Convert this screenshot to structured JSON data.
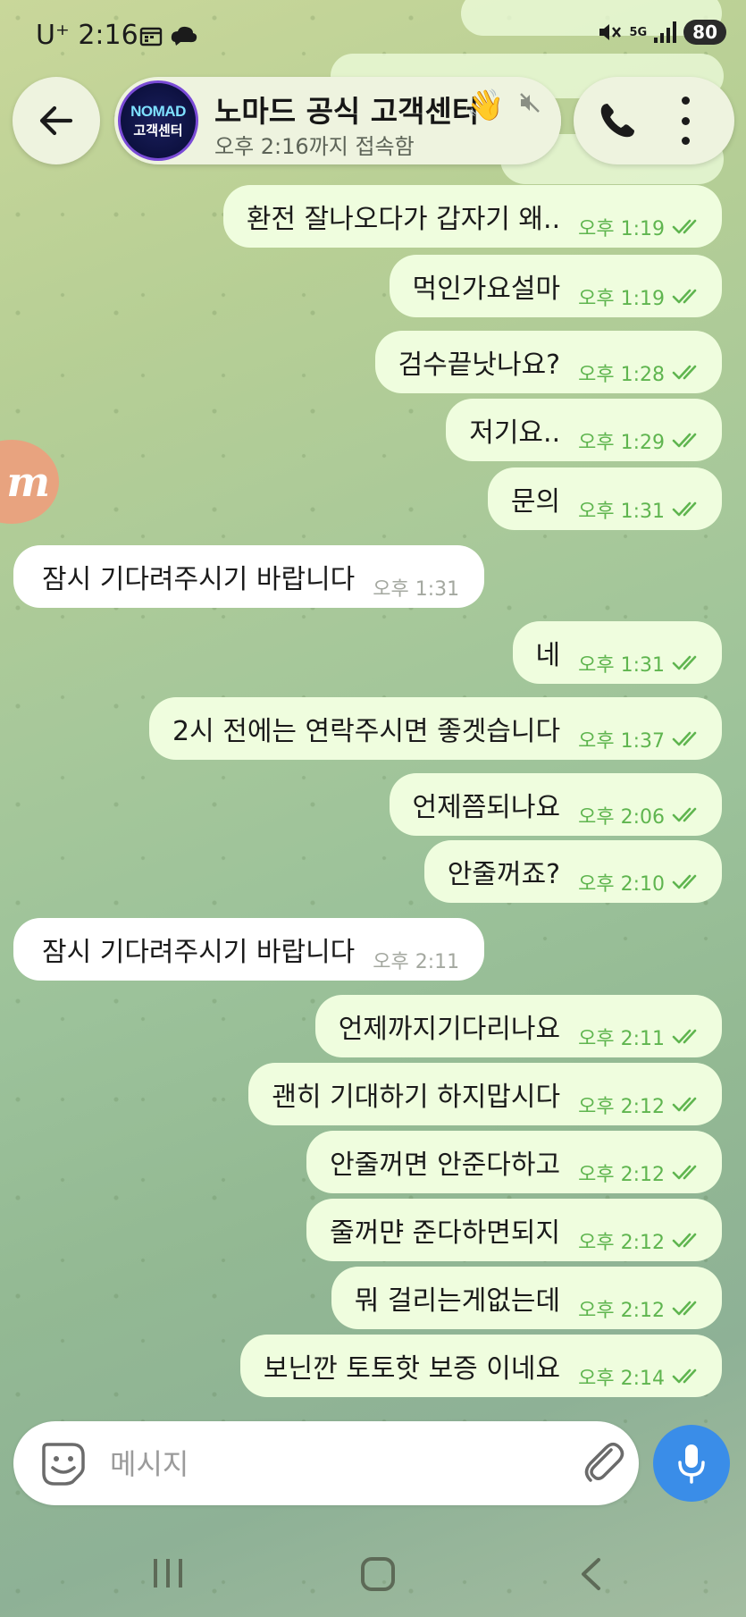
{
  "status_bar": {
    "carrier": "U⁺",
    "time": "2:16",
    "network": "5G",
    "battery": "80"
  },
  "header": {
    "chat_name": "노마드 공식 고객센터",
    "status": "오후 2:16까지 접속함",
    "avatar_line1": "NOMAD",
    "avatar_line2": "고객센터",
    "wave_emoji": "👋"
  },
  "messages": [
    {
      "dir": "out",
      "text": "환전 잘나오다가 갑자기 왜..",
      "time": "오후 1:19"
    },
    {
      "dir": "out",
      "text": "먹인가요설마",
      "time": "오후 1:19"
    },
    {
      "dir": "out",
      "text": "검수끝낫나요?",
      "time": "오후 1:28"
    },
    {
      "dir": "out",
      "text": "저기요..",
      "time": "오후 1:29"
    },
    {
      "dir": "out",
      "text": "문의",
      "time": "오후 1:31"
    },
    {
      "dir": "in",
      "text": "잠시 기다려주시기 바랍니다",
      "time": "오후 1:31"
    },
    {
      "dir": "out",
      "text": "네",
      "time": "오후 1:31"
    },
    {
      "dir": "out",
      "text": "2시 전에는 연락주시면 좋겟습니다",
      "time": "오후 1:37"
    },
    {
      "dir": "out",
      "text": "언제쯤되나요",
      "time": "오후 2:06"
    },
    {
      "dir": "out",
      "text": "안줄꺼죠?",
      "time": "오후 2:10"
    },
    {
      "dir": "in",
      "text": "잠시 기다려주시기 바랍니다",
      "time": "오후 2:11"
    },
    {
      "dir": "out",
      "text": "언제까지기다리나요",
      "time": "오후 2:11"
    },
    {
      "dir": "out",
      "text": "괜히 기대하기 하지맙시다",
      "time": "오후 2:12"
    },
    {
      "dir": "out",
      "text": "안줄꺼면 안준다하고",
      "time": "오후 2:12"
    },
    {
      "dir": "out",
      "text": "줄꺼먄 준다하면되지",
      "time": "오후 2:12"
    },
    {
      "dir": "out",
      "text": "뭐 걸리는게없는데",
      "time": "오후 2:12"
    },
    {
      "dir": "out",
      "text": "보닌깐 토토핫 보증 이네요",
      "time": "오후 2:14"
    }
  ],
  "input": {
    "placeholder": "메시지"
  },
  "side_badge": "m",
  "colors": {
    "outgoing_bubble": "#effdde",
    "incoming_bubble": "#ffffff",
    "check_green": "#5fb54f",
    "mic_blue": "#3a8de8"
  }
}
